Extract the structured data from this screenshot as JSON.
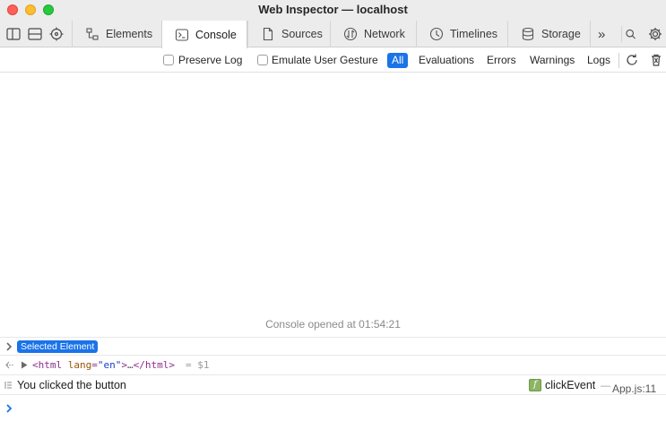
{
  "window": {
    "title": "Web Inspector — localhost"
  },
  "toolbar": {
    "left_icons": [
      "dock-side-icon",
      "dock-bottom-icon",
      "element-picker-icon"
    ],
    "tabs": [
      {
        "label": "Elements",
        "icon": "elements-icon",
        "active": false
      },
      {
        "label": "Console",
        "icon": "console-icon",
        "active": true
      },
      {
        "label": "Sources",
        "icon": "sources-icon",
        "active": false
      },
      {
        "label": "Network",
        "icon": "network-icon",
        "active": false
      },
      {
        "label": "Timelines",
        "icon": "timelines-icon",
        "active": false
      },
      {
        "label": "Storage",
        "icon": "storage-icon",
        "active": false
      }
    ],
    "overflow_label": "»",
    "right_icons": [
      "search-icon",
      "gear-icon"
    ]
  },
  "filter_bar": {
    "preserve_log": {
      "label": "Preserve Log",
      "checked": false
    },
    "emulate_user_gesture": {
      "label": "Emulate User Gesture",
      "checked": false
    },
    "filters": [
      {
        "label": "All",
        "active": true
      },
      {
        "label": "Evaluations",
        "active": false
      },
      {
        "label": "Errors",
        "active": false
      },
      {
        "label": "Warnings",
        "active": false
      },
      {
        "label": "Logs",
        "active": false
      }
    ],
    "right_icons": [
      "reload-icon",
      "trash-icon"
    ]
  },
  "console": {
    "opened_message": "Console opened at 01:54:21",
    "selected_element_badge": "Selected Element",
    "html_node": {
      "open_tag": "<html",
      "attr_name": "lang",
      "attr_eq": "=",
      "attr_value": "\"en\"",
      "close_open": ">",
      "ellipsis": "…",
      "close_tag": "</html>",
      "variable": "= $1"
    },
    "log_entry": {
      "message": "You clicked the button",
      "function_name": "clickEvent",
      "function_icon_letter": "f",
      "dash": "—",
      "source": "App.js:11"
    }
  },
  "colors": {
    "accent": "#1a73e8",
    "function_icon": "#8bb463",
    "traffic_close": "#fe5f57",
    "traffic_min": "#febc2e",
    "traffic_max": "#28c840"
  }
}
